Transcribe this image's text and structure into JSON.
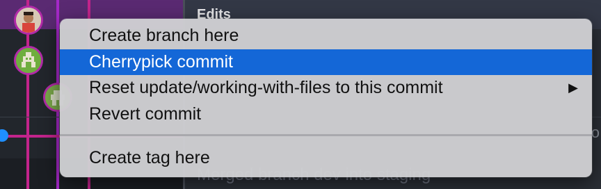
{
  "background": {
    "commit_title": "Edits",
    "commit_message": "Merged branch dev into staging",
    "commit_trail": "o"
  },
  "context_menu": {
    "items": [
      {
        "label": "Create branch here",
        "highlighted": false
      },
      {
        "label": "Cherrypick commit",
        "highlighted": true
      },
      {
        "label": "Reset update/working-with-files to this commit",
        "highlighted": false,
        "submenu_icon": "triangle-right-icon",
        "submenu_glyph": "▶"
      },
      {
        "label": "Revert commit",
        "highlighted": false
      }
    ],
    "items_after_separator": [
      {
        "label": "Create tag here",
        "highlighted": false
      }
    ]
  },
  "colors": {
    "highlight": "#1467d7",
    "lane_pink": "#c3248c",
    "lane_purple": "#a629c9",
    "branch_dot": "#1f8fff"
  }
}
